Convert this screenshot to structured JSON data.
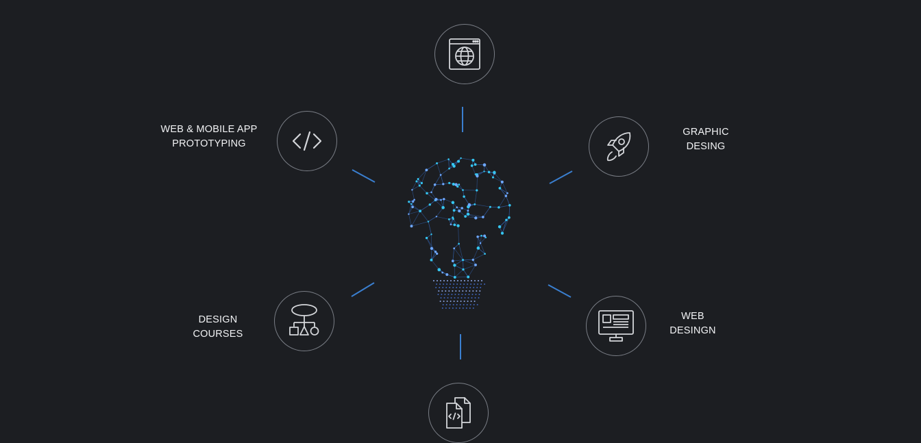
{
  "accent_color": "#3a7fd0",
  "services": [
    {
      "id": "web",
      "icon": "globe-browser-icon",
      "label": []
    },
    {
      "id": "prototyping",
      "icon": "code-brackets-icon",
      "label": [
        "WEB & MOBILE APP",
        "PROTOTYPING"
      ]
    },
    {
      "id": "graphic",
      "icon": "rocket-icon",
      "label": [
        "GRAPHIC",
        "DESING"
      ]
    },
    {
      "id": "courses",
      "icon": "flowchart-shapes-icon",
      "label": [
        "DESIGN",
        "COURSES"
      ]
    },
    {
      "id": "webdesign",
      "icon": "monitor-layout-icon",
      "label": [
        "WEB",
        "DESINGN"
      ]
    },
    {
      "id": "code-files",
      "icon": "code-files-icon",
      "label": []
    }
  ],
  "center_graphic": "network-lightbulb-icon"
}
